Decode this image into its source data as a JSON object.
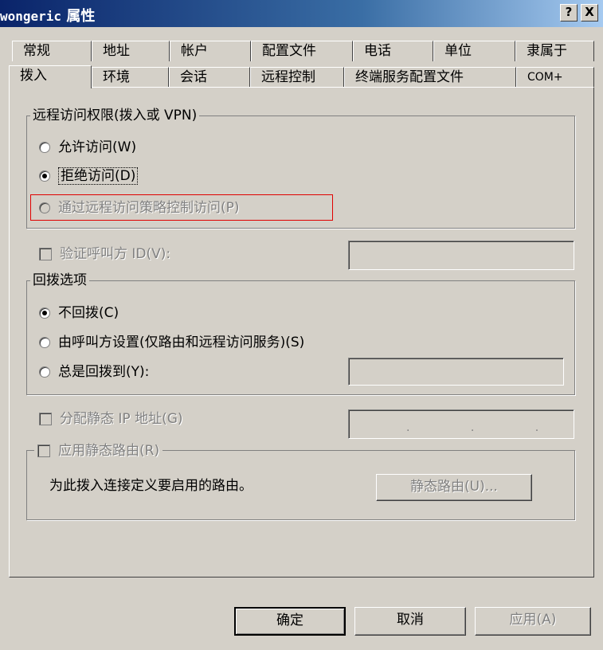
{
  "window": {
    "title_name": "wongeric",
    "title_suffix": "属性",
    "help_button": "?",
    "close_button": "X"
  },
  "tabs": {
    "row1": [
      "常规",
      "地址",
      "帐户",
      "配置文件",
      "电话",
      "单位",
      "隶属于"
    ],
    "row2": [
      "拨入",
      "环境",
      "会话",
      "远程控制",
      "终端服务配置文件",
      "COM+"
    ],
    "active": "拨入"
  },
  "remote_access": {
    "legend": "远程访问权限(拨入或 VPN)",
    "allow": "允许访问(W)",
    "deny": "拒绝访问(D)",
    "policy": "通过远程访问策略控制访问(P)",
    "selected": "deny"
  },
  "verify_caller_id": {
    "label": "验证呼叫方 ID(V):",
    "value": ""
  },
  "callback": {
    "legend": "回拨选项",
    "no_callback": "不回拨(C)",
    "set_by_caller": "由呼叫方设置(仅路由和远程访问服务)(S)",
    "always_callback": "总是回拨到(Y):",
    "always_value": "",
    "selected": "no_callback"
  },
  "static_ip": {
    "label": "分配静态 IP 地址(G)",
    "value": ". . ."
  },
  "static_routes": {
    "legend": "应用静态路由(R)",
    "description": "为此拨入连接定义要启用的路由。",
    "button": "静态路由(U)..."
  },
  "footer": {
    "ok": "确定",
    "cancel": "取消",
    "apply": "应用(A)"
  }
}
